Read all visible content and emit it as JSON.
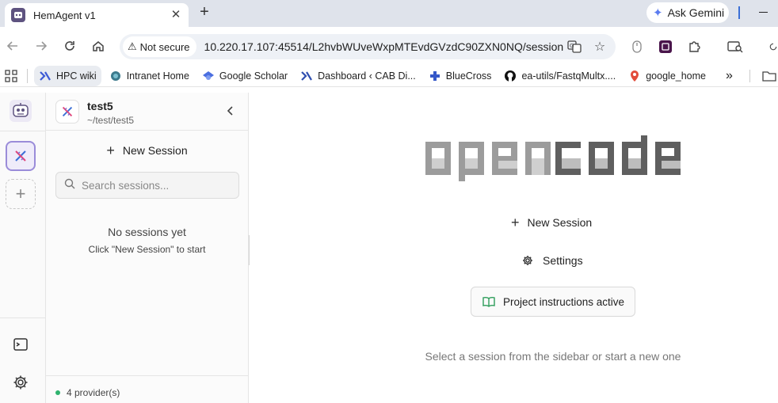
{
  "browser": {
    "tab_title": "HemAgent v1",
    "tab_close": "✕",
    "new_tab": "+",
    "gemini_label": "Ask Gemini",
    "security_label": "Not secure",
    "url": "10.220.17.107:45514/L2hvbWUveWxpMTEvdGVzdC90ZXN0NQ/session",
    "bookmarks": [
      {
        "label": "HPC wiki",
        "icon": "hpc-icon",
        "color": "#3d5bd6"
      },
      {
        "label": "Intranet Home",
        "icon": "intranet-icon",
        "color": "#3c7a8c"
      },
      {
        "label": "Google Scholar",
        "icon": "scholar-icon",
        "color": "#4a6ee0"
      },
      {
        "label": "Dashboard ‹ CAB Di...",
        "icon": "dashboard-icon",
        "color": "#2f4fb0"
      },
      {
        "label": "BlueCross",
        "icon": "bluecross-icon",
        "color": "#3558c8"
      },
      {
        "label": "ea-utils/FastqMultx....",
        "icon": "github-icon",
        "color": "#111111"
      },
      {
        "label": "google_home",
        "icon": "maps-pin-icon",
        "color": "#e24c3b"
      }
    ],
    "more_bookmarks": "»"
  },
  "app": {
    "project": {
      "name": "test5",
      "path": "~/test/test5"
    },
    "sidebar": {
      "new_session_label": "New Session",
      "search_placeholder": "Search sessions...",
      "empty_title": "No sessions yet",
      "empty_subtitle": "Click \"New Session\" to start",
      "providers_label": "4 provider(s)",
      "provider_status_color": "#2fb36e"
    },
    "main": {
      "logo_text": "opencode",
      "new_session_label": "New Session",
      "settings_label": "Settings",
      "instructions_label": "Project instructions active",
      "instructions_color": "#2e9d5b",
      "hint": "Select a session from the sidebar or start a new one"
    }
  }
}
